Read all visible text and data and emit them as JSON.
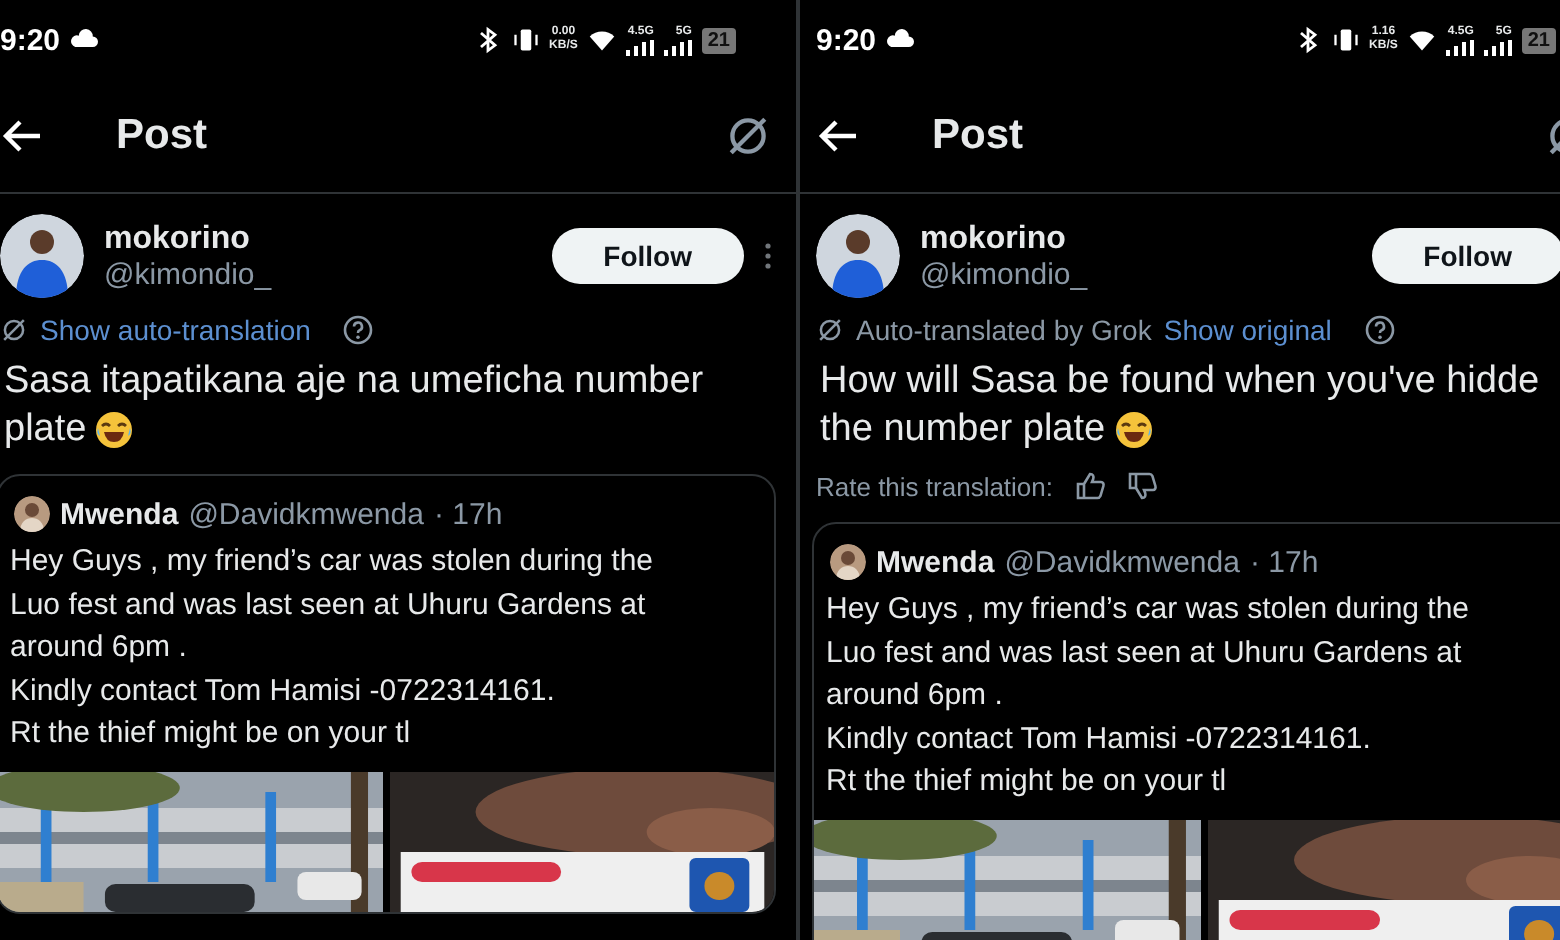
{
  "screens": [
    {
      "status_bar": {
        "time": "9:20",
        "speed_value": "0.00",
        "speed_unit": "KB/S",
        "signals": [
          "4.5G",
          "5G"
        ],
        "battery": "21"
      },
      "header": {
        "title": "Post"
      },
      "post": {
        "author": "mokorino",
        "handle": "@kimondio_",
        "follow": "Follow",
        "translation": {
          "kind": "prompt",
          "link": "Show auto-translation"
        },
        "lines": [
          "Sasa itapatikana aje na umeficha number",
          "plate"
        ],
        "quote": {
          "author": "Mwenda",
          "handle": "@Davidkmwenda",
          "time": "· 17h",
          "lines": [
            "Hey Guys , my friend’s car was stolen during the",
            "Luo fest and was last seen at Uhuru Gardens at",
            "around 6pm .",
            "Kindly contact Tom Hamisi -0722314161.",
            "Rt the thief might be on your tl"
          ]
        }
      }
    },
    {
      "status_bar": {
        "time": "9:20",
        "speed_value": "1.16",
        "speed_unit": "KB/S",
        "signals": [
          "4.5G",
          "5G"
        ],
        "battery": "21"
      },
      "header": {
        "title": "Post"
      },
      "post": {
        "author": "mokorino",
        "handle": "@kimondio_",
        "follow": "Follow",
        "translation": {
          "kind": "translated",
          "label": "Auto-translated by Grok",
          "link": "Show original",
          "rate_label": "Rate this translation:"
        },
        "lines": [
          "How will Sasa be found when you've hidde",
          "the number plate"
        ],
        "quote": {
          "author": "Mwenda",
          "handle": "@Davidkmwenda",
          "time": "· 17h",
          "lines": [
            "Hey Guys , my friend’s car was stolen during the",
            "Luo fest and was last seen at Uhuru Gardens at",
            "around 6pm .",
            "Kindly contact Tom Hamisi -0722314161.",
            "Rt the thief might be on your tl"
          ]
        }
      }
    }
  ]
}
